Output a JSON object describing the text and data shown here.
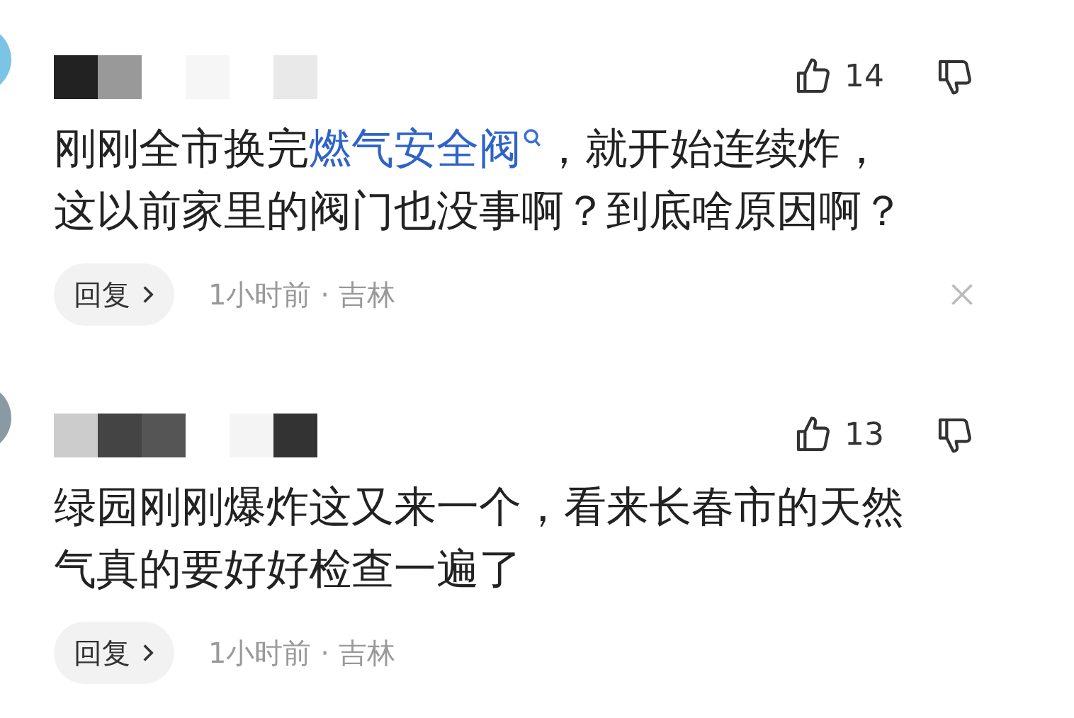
{
  "comments": [
    {
      "likes": "14",
      "text_before": "刚刚全市换完",
      "link": "燃气安全阀",
      "text_after": "，就开始连续炸，这以前家里的阀门也没事啊？到底啥原因啊？",
      "reply": "回复",
      "meta": "1小时前 · 吉林",
      "closable": true
    },
    {
      "likes": "13",
      "text_before": "绿园刚刚爆炸这又来一个，看来长春市的天然气真的要好好检查一遍了",
      "reply": "回复",
      "meta": "1小时前 · 吉林",
      "closable": false
    }
  ]
}
